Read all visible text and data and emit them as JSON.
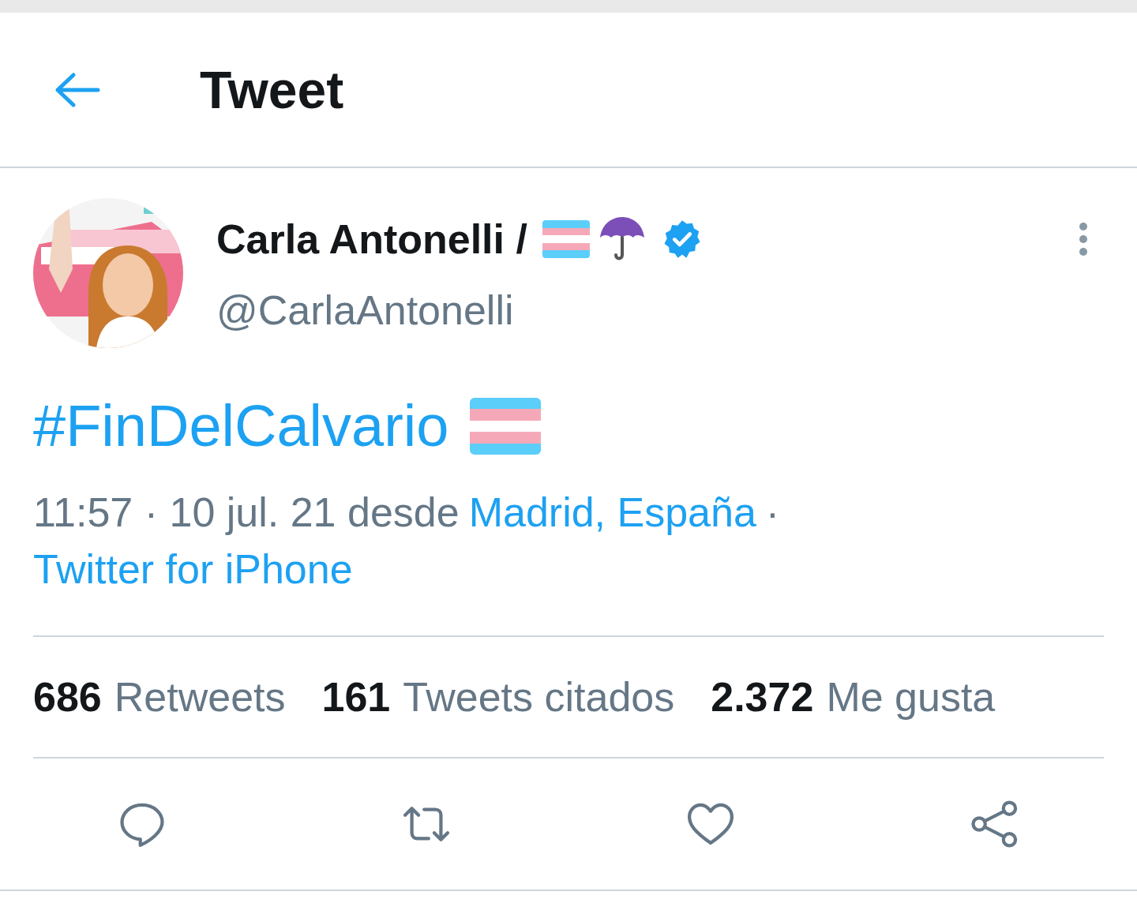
{
  "header": {
    "title": "Tweet"
  },
  "tweet": {
    "author": {
      "name": "Carla Antonelli /",
      "verified": true,
      "handle": "@CarlaAntonelli"
    },
    "hashtag": "#FinDelCalvario",
    "meta": {
      "time": "11:57 · 10 jul. 21 desde",
      "place": "Madrid, España",
      "separator": "·",
      "source": "Twitter for iPhone"
    },
    "stats": [
      {
        "count": "686",
        "label": "Retweets"
      },
      {
        "count": "161",
        "label": "Tweets citados"
      },
      {
        "count": "2.372",
        "label": "Me gusta"
      }
    ],
    "actions": [
      {
        "kind": "reply"
      },
      {
        "kind": "retweet"
      },
      {
        "kind": "like"
      },
      {
        "kind": "share"
      }
    ]
  }
}
